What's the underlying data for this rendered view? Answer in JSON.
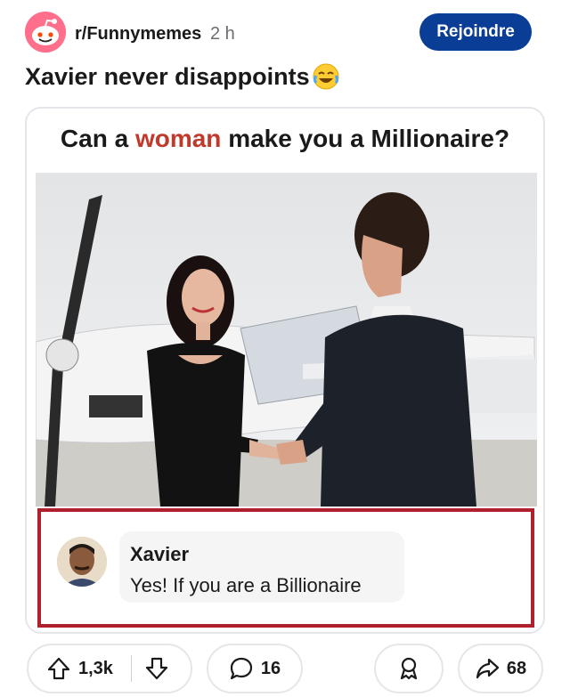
{
  "header": {
    "subreddit": "r/Funnymemes",
    "age": "2 h",
    "join_label": "Rejoindre"
  },
  "post": {
    "title": "Xavier never disappoints",
    "emoji": "face-with-tears-of-joy"
  },
  "meme": {
    "question_before": "Can a ",
    "question_highlight": "woman",
    "question_after": " make you a Millionaire?",
    "reply_name": "Xavier",
    "reply_text": "Yes! If you are a Billionaire"
  },
  "actions": {
    "upvotes": "1,3k",
    "comments": "16",
    "shares": "68"
  },
  "colors": {
    "join_button": "#0a3d96",
    "highlight_red": "#c0392b",
    "reply_border": "#b01f2c"
  }
}
